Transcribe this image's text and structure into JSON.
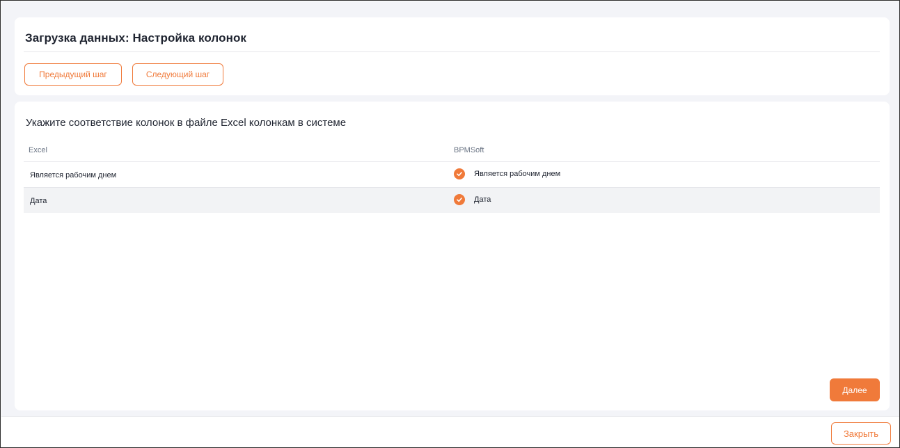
{
  "header": {
    "title": "Загрузка данных: Настройка колонок",
    "prev_label": "Предыдущий шаг",
    "next_label": "Следующий шаг"
  },
  "mapping": {
    "instruction": "Укажите соответствие колонок в файле Excel колонкам в системе",
    "columns": {
      "excel": "Excel",
      "system": "BPMSoft"
    },
    "rows": [
      {
        "excel": "Является рабочим днем",
        "system": "Является рабочим днем",
        "checked": true
      },
      {
        "excel": "Дата",
        "system": "Дата",
        "checked": true
      }
    ],
    "continue_label": "Далее"
  },
  "footer": {
    "close_label": "Закрыть"
  },
  "colors": {
    "accent": "#f07a3a",
    "background": "#f3f4f8",
    "row_highlight": "#f2f3f5"
  },
  "icons": {
    "checkbox": "check-circle-icon"
  }
}
